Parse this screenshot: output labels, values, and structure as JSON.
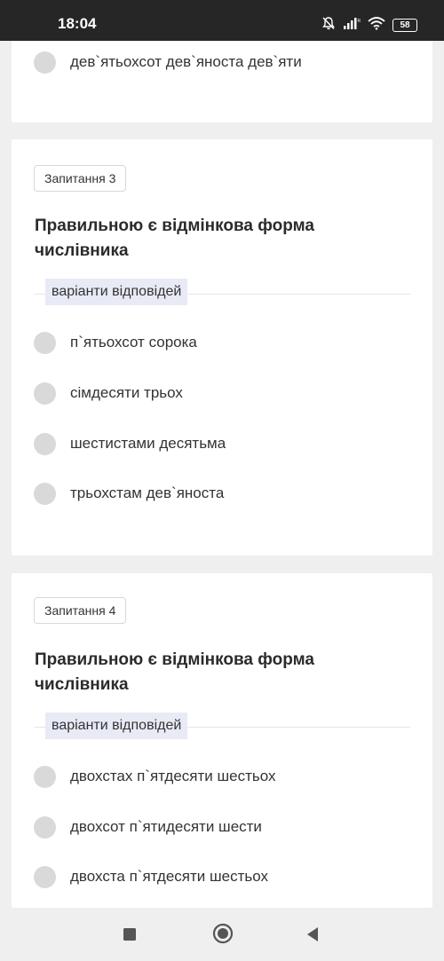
{
  "status_bar": {
    "time": "18:04",
    "battery": "58",
    "icons": [
      "mute-icon",
      "signal-icon",
      "wifi-icon",
      "battery-icon"
    ]
  },
  "card_prev": {
    "options": [
      {
        "label": "дев`ятьохсот дев`яноста дев`яти"
      }
    ]
  },
  "question3": {
    "badge": "Запитання 3",
    "title": "Правильною є відмінкова форма числівника",
    "answers_label": "варіанти відповідей",
    "options": [
      {
        "label": "п`ятьохсот сорока"
      },
      {
        "label": "сімдесяти трьох"
      },
      {
        "label": "шестистами десятьма"
      },
      {
        "label": "трьохстам дев`яноста"
      }
    ]
  },
  "question4": {
    "badge": "Запитання 4",
    "title": "Правильною є відмінкова форма числівника",
    "answers_label": "варіанти відповідей",
    "options": [
      {
        "label": "двохстах п`ятдесяти шестьох"
      },
      {
        "label": "двохсот п`ятидесяти шести"
      },
      {
        "label": "двохста п`ятдесяти шестьох"
      }
    ]
  },
  "nav_bar": {
    "buttons": [
      "recents-button",
      "home-button",
      "back-button"
    ]
  },
  "colors": {
    "background": "#efefef",
    "card": "#ffffff",
    "status_bar": "#262626",
    "radio": "#d9d9d9",
    "answers_label_bg": "#e8eaf6"
  }
}
